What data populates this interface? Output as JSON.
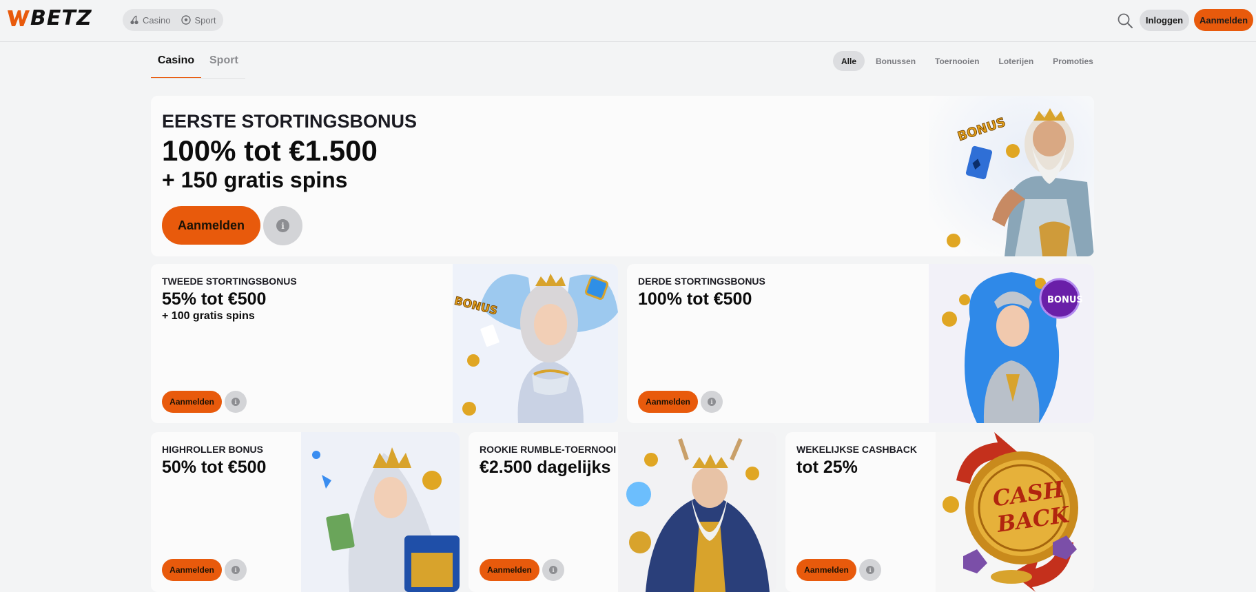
{
  "brand": {
    "name": "WBETZ",
    "accent": "#e85a0c"
  },
  "header": {
    "modes": [
      {
        "label": "Casino",
        "icon": "cherries-icon"
      },
      {
        "label": "Sport",
        "icon": "football-icon"
      }
    ],
    "search_icon": "search-icon",
    "login_label": "Inloggen",
    "signup_label": "Aanmelden"
  },
  "tabs": {
    "main": [
      "Casino",
      "Sport"
    ],
    "active_main": "Casino",
    "filters": [
      "Alle",
      "Bonussen",
      "Toernooien",
      "Loterijen",
      "Promoties"
    ],
    "active_filter": "Alle"
  },
  "promotions": {
    "hero": {
      "label": "EERSTE STORTINGSBONUS",
      "headline": "100% tot €1.500",
      "sub": "+ 150 gratis spins",
      "cta": "Aanmelden",
      "art": "zeus-bonus-illustration"
    },
    "cards": [
      {
        "label": "TWEEDE STORTINGSBONUS",
        "headline": "55% tot €500",
        "sub": "+ 100 gratis spins",
        "cta": "Aanmelden",
        "art": "fairy-bonus-illustration"
      },
      {
        "label": "DERDE STORTINGSBONUS",
        "headline": "100% tot €500",
        "sub": "",
        "cta": "Aanmelden",
        "art": "warrior-bonus-illustration"
      },
      {
        "label": "HIGHROLLER BONUS",
        "headline": "50% tot €500",
        "sub": "",
        "cta": "Aanmelden",
        "art": "queen-treasure-illustration"
      },
      {
        "label": "ROOKIE RUMBLE-TOERNOOI",
        "headline": "€2.500 dagelijks",
        "sub": "",
        "cta": "Aanmelden",
        "art": "wizard-tournament-illustration"
      },
      {
        "label": "WEKELIJKSE CASHBACK",
        "headline": "tot 25%",
        "sub": "",
        "cta": "Aanmelden",
        "art": "cashback-coin-illustration"
      }
    ],
    "art_text": {
      "hero_badge": "BONUS",
      "fairy_badge": "BONUS",
      "warrior_badge": "BONUS",
      "cashback_line1": "CASH",
      "cashback_line2": "BACK"
    }
  }
}
